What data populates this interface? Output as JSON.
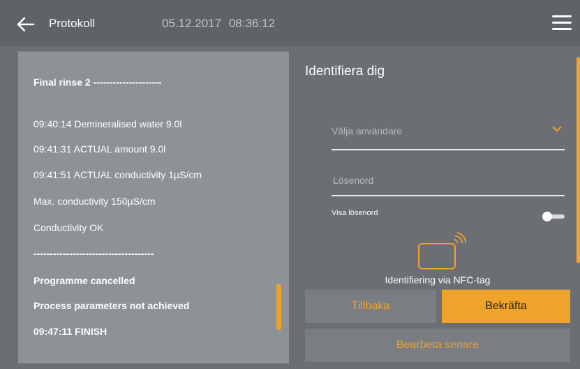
{
  "header": {
    "title": "Protokoll",
    "date": "05.12.2017",
    "time": "08:36:12"
  },
  "log": {
    "lines": [
      {
        "text": "Final rinse 2 ---------------------",
        "bold": true
      },
      {
        "text": "09:40:14 Demineralised water 9.0l",
        "bold": false
      },
      {
        "text": "09:41:31 ACTUAL amount 9.0l",
        "bold": false
      },
      {
        "text": "09:41:51 ACTUAL conductivity 1µS/cm",
        "bold": false
      },
      {
        "text": "Max. conductivity 150µS/cm",
        "bold": false
      },
      {
        "text": "Conductivity OK",
        "bold": false
      },
      {
        "text": "-------------------------------------",
        "bold": true
      },
      {
        "text": "Programme cancelled",
        "bold": true
      },
      {
        "text": "Process parameters not achieved",
        "bold": true
      },
      {
        "text": "09:47:11 FINISH",
        "bold": true
      }
    ]
  },
  "form": {
    "title": "Identifiera dig",
    "user_select_placeholder": "Välja användare",
    "password_placeholder": "Lösenord",
    "show_password_label": "Visa lösenord",
    "show_password_on": false,
    "nfc_label": "Identifiering via NFC-tag",
    "back_label": "Tillbaka",
    "confirm_label": "Bekräfta",
    "later_label": "Bearbeta senare"
  },
  "colors": {
    "accent": "#f0a32a",
    "header_bg": "#5f6266",
    "panel_bg": "#8e9195",
    "page_bg": "#6b6e72"
  },
  "icons": {
    "back": "back-arrow-icon",
    "menu": "hamburger-menu-icon",
    "chevron": "chevron-down-icon",
    "nfc": "nfc-card-icon"
  }
}
